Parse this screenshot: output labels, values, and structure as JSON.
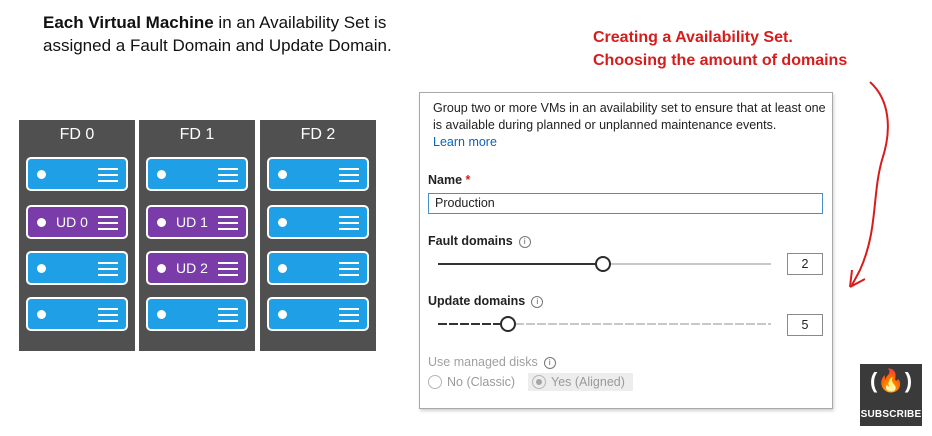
{
  "intro": {
    "bold": "Each Virtual Machine",
    "rest": " in an Availability Set is assigned a Fault Domain and Update Domain."
  },
  "fault_domains": [
    {
      "label": "FD 0",
      "slots": [
        {
          "ud": ""
        },
        {
          "ud": "UD 0"
        },
        {
          "ud": ""
        },
        {
          "ud": ""
        }
      ]
    },
    {
      "label": "FD 1",
      "slots": [
        {
          "ud": ""
        },
        {
          "ud": "UD 1"
        },
        {
          "ud": "UD 2"
        },
        {
          "ud": ""
        }
      ]
    },
    {
      "label": "FD 2",
      "slots": [
        {
          "ud": ""
        },
        {
          "ud": ""
        },
        {
          "ud": ""
        },
        {
          "ud": ""
        }
      ]
    }
  ],
  "annotation": {
    "line1": "Creating a Availability Set.",
    "line2": "Choosing the amount of domains"
  },
  "panel": {
    "description": "Group two or more VMs in an availability set to ensure that at least one is available during planned or unplanned maintenance events.",
    "learn_more": "Learn more",
    "name_label": "Name",
    "required_marker": "*",
    "name_value": "Production",
    "fault_label": "Fault domains",
    "fault_value": "2",
    "fault_fraction": 0.5,
    "update_label": "Update domains",
    "update_value": "5",
    "update_fraction": 0.2,
    "managed_label": "Use managed disks",
    "radio_no": "No (Classic)",
    "radio_yes": "Yes (Aligned)",
    "info_glyph": "i"
  },
  "colors": {
    "vm_blue": "#1e9fe6",
    "ud_purple": "#7a3ca9",
    "annotation_red": "#d81c1c",
    "link_blue": "#0a63b8"
  },
  "logo": {
    "glyph": "(🔥)",
    "text": "SUBSCRIBE"
  }
}
